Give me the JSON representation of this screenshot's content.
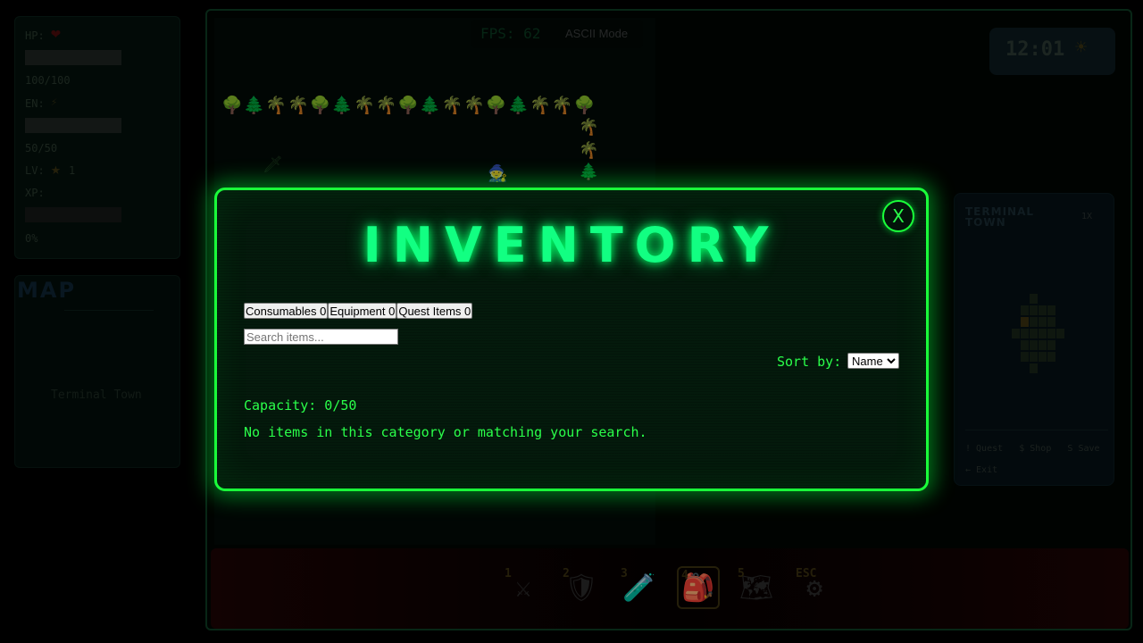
{
  "stats": {
    "hp_label": "HP:",
    "hp_icon": "heart-icon",
    "hp_value": "100/100",
    "en_label": "EN:",
    "en_icon": "lightning-icon",
    "en_value": "50/50",
    "lv_label": "LV:",
    "lv_icon": "star-icon",
    "lv_value": "1",
    "xp_label": "XP:",
    "xp_value": "0%",
    "hp_fraction": 1.0,
    "en_fraction": 1.0,
    "xp_fraction": 0.0
  },
  "map": {
    "title": "MAP",
    "location": "Terminal Town"
  },
  "hud": {
    "fps": "FPS: 62",
    "ascii_mode": "ASCII Mode",
    "clock": "12:01",
    "clock_icon": "sun-icon"
  },
  "town_panel": {
    "title": "TERMINAL TOWN",
    "zoom": "1X",
    "menu": [
      "! Quest",
      "$ Shop",
      "S Save",
      "← Exit"
    ]
  },
  "hotbar": {
    "active_slot": 4,
    "slots": [
      {
        "num": "1",
        "icon": "crossed-swords-icon",
        "glyph": "⚔"
      },
      {
        "num": "2",
        "icon": "shield-icon",
        "glyph": "🛡"
      },
      {
        "num": "3",
        "icon": "potion-icon",
        "glyph": "🧪"
      },
      {
        "num": "4",
        "icon": "backpack-icon",
        "glyph": "🎒"
      },
      {
        "num": "5",
        "icon": "map-icon",
        "glyph": "🗺"
      },
      {
        "num": "ESC",
        "icon": "gear-icon",
        "glyph": "⚙"
      }
    ]
  },
  "inventory": {
    "title": "INVENTORY",
    "close_label": "X",
    "tabs": [
      {
        "label": "Consumables 0"
      },
      {
        "label": "Equipment 0"
      },
      {
        "label": "Quest Items 0"
      }
    ],
    "search_placeholder": "Search items...",
    "sort_label": "Sort by:",
    "sort_selected": "Name",
    "capacity": "Capacity: 0/50",
    "empty_message": "No items in this category or matching your search."
  },
  "colors": {
    "accent": "#1aff3a",
    "title_glow": "#12ff82"
  }
}
